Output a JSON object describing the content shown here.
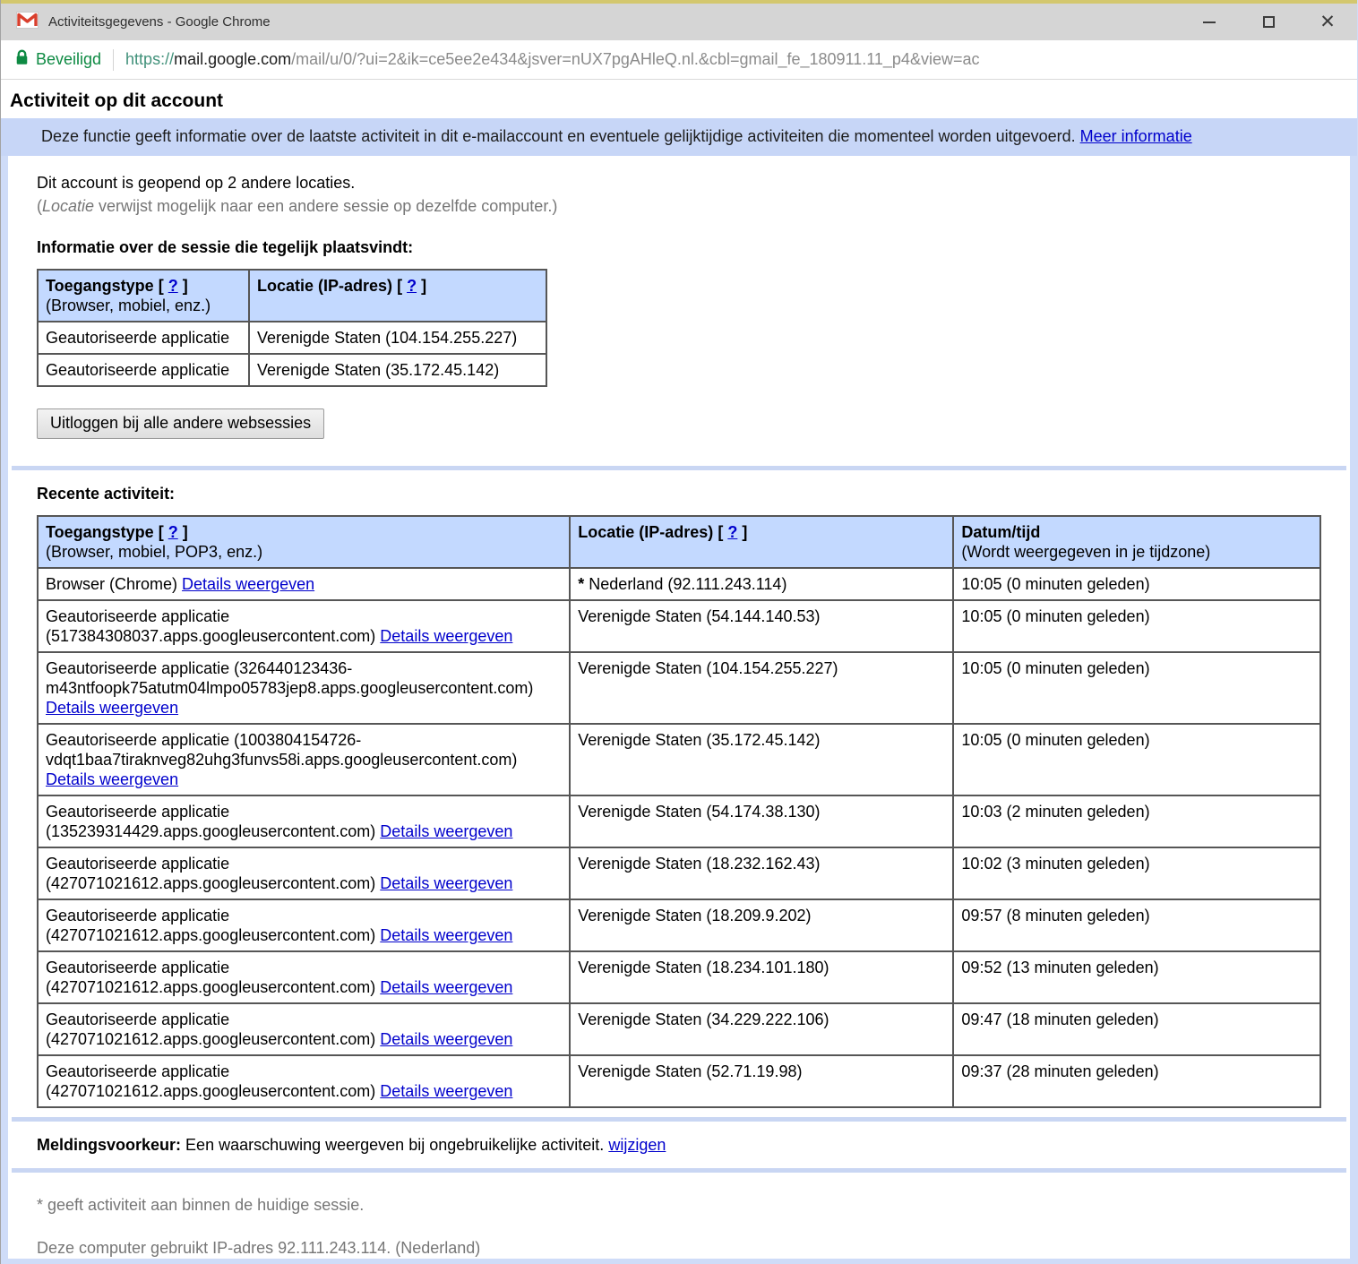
{
  "window": {
    "title": "Activiteitsgegevens - Google Chrome",
    "icons": {
      "app": "gmail-envelope-icon",
      "minimize": "minimize-icon",
      "maximize": "maximize-icon",
      "close": "close-icon",
      "security": "padlock-icon"
    }
  },
  "address_bar": {
    "security_label": "Beveiligd",
    "url": {
      "scheme": "https://",
      "host": "mail.google.com",
      "path": "/mail/u/0/?ui=2&ik=ce5ee2e434&jsver=nUX7pgAHleQ.nl.&cbl=gmail_fe_180911.11_p4&view=ac"
    }
  },
  "colors": {
    "secure_green": "#0e8a43",
    "link_blue": "#0000cc",
    "table_header_bg": "#c3d9ff",
    "info_bar_bg": "#c7d6f7",
    "frame_bg": "#cfdcf8",
    "divider_blue": "#c9d6f3",
    "table_border": "#565656"
  },
  "page": {
    "title": "Activiteit op dit account",
    "info_bar": {
      "text": "Deze functie geeft informatie over de laatste activiteit in dit e-mailaccount en eventuele gelijktijdige activiteiten die momenteel worden uitgevoerd.",
      "link_label": "Meer informatie"
    },
    "summary_line": "Dit account is geopend op 2 andere locaties.",
    "summary_note": {
      "open_paren": "(",
      "italic_word": "Locatie",
      "rest": " verwijst mogelijk naar een andere sessie op dezelfde computer.)"
    },
    "brackets": {
      "open": "[",
      "close": "]"
    },
    "help_symbol": "?",
    "concurrent_section": {
      "heading": "Informatie over de sessie die tegelijk plaatsvindt:",
      "table": {
        "col1_title": "Toegangstype",
        "col1_sub": "(Browser, mobiel, enz.)",
        "col2_title": "Locatie (IP-adres)",
        "rows": [
          {
            "access": "Geautoriseerde applicatie",
            "location": "Verenigde Staten (104.154.255.227)"
          },
          {
            "access": "Geautoriseerde applicatie",
            "location": "Verenigde Staten (35.172.45.142)"
          }
        ]
      },
      "signout_button_label": "Uitloggen bij alle andere websessies"
    },
    "recent_section": {
      "heading": "Recente activiteit:",
      "table": {
        "col1_title": "Toegangstype",
        "col1_sub": "(Browser, mobiel, POP3, enz.)",
        "col2_title": "Locatie (IP-adres)",
        "col3_title": "Datum/tijd",
        "col3_sub": "(Wordt weergegeven in je tijdzone)",
        "details_label": "Details weergeven",
        "rows": [
          {
            "access": "Browser (Chrome)",
            "star": "*",
            "location": "Nederland (92.111.243.114)",
            "time": "10:05 (0 minuten geleden)"
          },
          {
            "access": "Geautoriseerde applicatie (517384308037.apps.googleusercontent.com)",
            "star": "",
            "location": "Verenigde Staten (54.144.140.53)",
            "time": "10:05 (0 minuten geleden)"
          },
          {
            "access": "Geautoriseerde applicatie (326440123436-m43ntfoopk75atutm04lmpo05783jep8.apps.googleusercontent.com)",
            "star": "",
            "location": "Verenigde Staten (104.154.255.227)",
            "time": "10:05 (0 minuten geleden)"
          },
          {
            "access": "Geautoriseerde applicatie (1003804154726-vdqt1baa7tiraknveg82uhg3funvs58i.apps.googleusercontent.com)",
            "star": "",
            "location": "Verenigde Staten (35.172.45.142)",
            "time": "10:05 (0 minuten geleden)"
          },
          {
            "access": "Geautoriseerde applicatie (135239314429.apps.googleusercontent.com)",
            "star": "",
            "location": "Verenigde Staten (54.174.38.130)",
            "time": "10:03 (2 minuten geleden)"
          },
          {
            "access": "Geautoriseerde applicatie (427071021612.apps.googleusercontent.com)",
            "star": "",
            "location": "Verenigde Staten (18.232.162.43)",
            "time": "10:02 (3 minuten geleden)"
          },
          {
            "access": "Geautoriseerde applicatie (427071021612.apps.googleusercontent.com)",
            "star": "",
            "location": "Verenigde Staten (18.209.9.202)",
            "time": "09:57 (8 minuten geleden)"
          },
          {
            "access": "Geautoriseerde applicatie (427071021612.apps.googleusercontent.com)",
            "star": "",
            "location": "Verenigde Staten (18.234.101.180)",
            "time": "09:52 (13 minuten geleden)"
          },
          {
            "access": "Geautoriseerde applicatie (427071021612.apps.googleusercontent.com)",
            "star": "",
            "location": "Verenigde Staten (34.229.222.106)",
            "time": "09:47 (18 minuten geleden)"
          },
          {
            "access": "Geautoriseerde applicatie (427071021612.apps.googleusercontent.com)",
            "star": "",
            "location": "Verenigde Staten (52.71.19.98)",
            "time": "09:37 (28 minuten geleden)"
          }
        ]
      }
    },
    "alert_preference": {
      "label": "Meldingsvoorkeur:",
      "text": "Een waarschuwing weergeven bij ongebruikelijke activiteit.",
      "link_label": "wijzigen"
    },
    "notes": [
      "* geeft activiteit aan binnen de huidige sessie.",
      "Deze computer gebruikt IP-adres 92.111.243.114. (Nederland)"
    ]
  }
}
